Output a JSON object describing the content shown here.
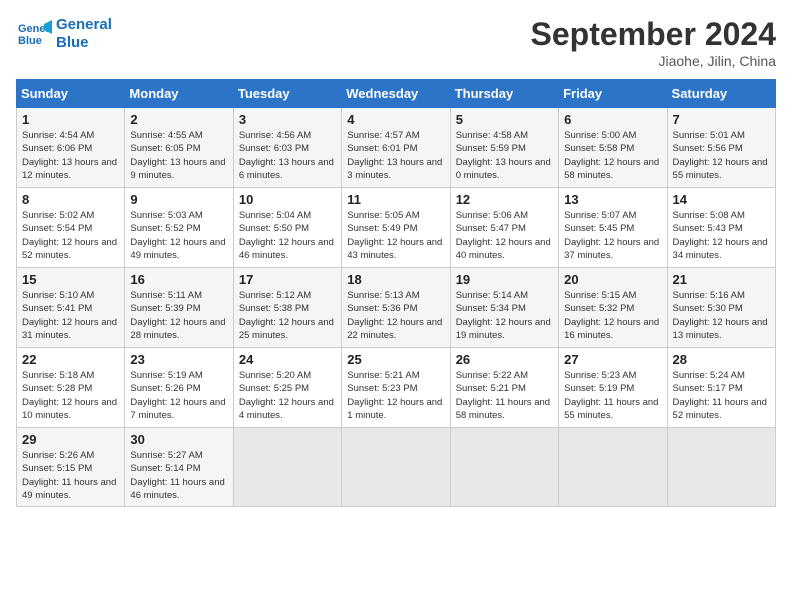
{
  "header": {
    "logo_line1": "General",
    "logo_line2": "Blue",
    "month": "September 2024",
    "location": "Jiaohe, Jilin, China"
  },
  "weekdays": [
    "Sunday",
    "Monday",
    "Tuesday",
    "Wednesday",
    "Thursday",
    "Friday",
    "Saturday"
  ],
  "weeks": [
    [
      {
        "day": "1",
        "sunrise": "Sunrise: 4:54 AM",
        "sunset": "Sunset: 6:06 PM",
        "daylight": "Daylight: 13 hours and 12 minutes."
      },
      {
        "day": "2",
        "sunrise": "Sunrise: 4:55 AM",
        "sunset": "Sunset: 6:05 PM",
        "daylight": "Daylight: 13 hours and 9 minutes."
      },
      {
        "day": "3",
        "sunrise": "Sunrise: 4:56 AM",
        "sunset": "Sunset: 6:03 PM",
        "daylight": "Daylight: 13 hours and 6 minutes."
      },
      {
        "day": "4",
        "sunrise": "Sunrise: 4:57 AM",
        "sunset": "Sunset: 6:01 PM",
        "daylight": "Daylight: 13 hours and 3 minutes."
      },
      {
        "day": "5",
        "sunrise": "Sunrise: 4:58 AM",
        "sunset": "Sunset: 5:59 PM",
        "daylight": "Daylight: 13 hours and 0 minutes."
      },
      {
        "day": "6",
        "sunrise": "Sunrise: 5:00 AM",
        "sunset": "Sunset: 5:58 PM",
        "daylight": "Daylight: 12 hours and 58 minutes."
      },
      {
        "day": "7",
        "sunrise": "Sunrise: 5:01 AM",
        "sunset": "Sunset: 5:56 PM",
        "daylight": "Daylight: 12 hours and 55 minutes."
      }
    ],
    [
      {
        "day": "8",
        "sunrise": "Sunrise: 5:02 AM",
        "sunset": "Sunset: 5:54 PM",
        "daylight": "Daylight: 12 hours and 52 minutes."
      },
      {
        "day": "9",
        "sunrise": "Sunrise: 5:03 AM",
        "sunset": "Sunset: 5:52 PM",
        "daylight": "Daylight: 12 hours and 49 minutes."
      },
      {
        "day": "10",
        "sunrise": "Sunrise: 5:04 AM",
        "sunset": "Sunset: 5:50 PM",
        "daylight": "Daylight: 12 hours and 46 minutes."
      },
      {
        "day": "11",
        "sunrise": "Sunrise: 5:05 AM",
        "sunset": "Sunset: 5:49 PM",
        "daylight": "Daylight: 12 hours and 43 minutes."
      },
      {
        "day": "12",
        "sunrise": "Sunrise: 5:06 AM",
        "sunset": "Sunset: 5:47 PM",
        "daylight": "Daylight: 12 hours and 40 minutes."
      },
      {
        "day": "13",
        "sunrise": "Sunrise: 5:07 AM",
        "sunset": "Sunset: 5:45 PM",
        "daylight": "Daylight: 12 hours and 37 minutes."
      },
      {
        "day": "14",
        "sunrise": "Sunrise: 5:08 AM",
        "sunset": "Sunset: 5:43 PM",
        "daylight": "Daylight: 12 hours and 34 minutes."
      }
    ],
    [
      {
        "day": "15",
        "sunrise": "Sunrise: 5:10 AM",
        "sunset": "Sunset: 5:41 PM",
        "daylight": "Daylight: 12 hours and 31 minutes."
      },
      {
        "day": "16",
        "sunrise": "Sunrise: 5:11 AM",
        "sunset": "Sunset: 5:39 PM",
        "daylight": "Daylight: 12 hours and 28 minutes."
      },
      {
        "day": "17",
        "sunrise": "Sunrise: 5:12 AM",
        "sunset": "Sunset: 5:38 PM",
        "daylight": "Daylight: 12 hours and 25 minutes."
      },
      {
        "day": "18",
        "sunrise": "Sunrise: 5:13 AM",
        "sunset": "Sunset: 5:36 PM",
        "daylight": "Daylight: 12 hours and 22 minutes."
      },
      {
        "day": "19",
        "sunrise": "Sunrise: 5:14 AM",
        "sunset": "Sunset: 5:34 PM",
        "daylight": "Daylight: 12 hours and 19 minutes."
      },
      {
        "day": "20",
        "sunrise": "Sunrise: 5:15 AM",
        "sunset": "Sunset: 5:32 PM",
        "daylight": "Daylight: 12 hours and 16 minutes."
      },
      {
        "day": "21",
        "sunrise": "Sunrise: 5:16 AM",
        "sunset": "Sunset: 5:30 PM",
        "daylight": "Daylight: 12 hours and 13 minutes."
      }
    ],
    [
      {
        "day": "22",
        "sunrise": "Sunrise: 5:18 AM",
        "sunset": "Sunset: 5:28 PM",
        "daylight": "Daylight: 12 hours and 10 minutes."
      },
      {
        "day": "23",
        "sunrise": "Sunrise: 5:19 AM",
        "sunset": "Sunset: 5:26 PM",
        "daylight": "Daylight: 12 hours and 7 minutes."
      },
      {
        "day": "24",
        "sunrise": "Sunrise: 5:20 AM",
        "sunset": "Sunset: 5:25 PM",
        "daylight": "Daylight: 12 hours and 4 minutes."
      },
      {
        "day": "25",
        "sunrise": "Sunrise: 5:21 AM",
        "sunset": "Sunset: 5:23 PM",
        "daylight": "Daylight: 12 hours and 1 minute."
      },
      {
        "day": "26",
        "sunrise": "Sunrise: 5:22 AM",
        "sunset": "Sunset: 5:21 PM",
        "daylight": "Daylight: 11 hours and 58 minutes."
      },
      {
        "day": "27",
        "sunrise": "Sunrise: 5:23 AM",
        "sunset": "Sunset: 5:19 PM",
        "daylight": "Daylight: 11 hours and 55 minutes."
      },
      {
        "day": "28",
        "sunrise": "Sunrise: 5:24 AM",
        "sunset": "Sunset: 5:17 PM",
        "daylight": "Daylight: 11 hours and 52 minutes."
      }
    ],
    [
      {
        "day": "29",
        "sunrise": "Sunrise: 5:26 AM",
        "sunset": "Sunset: 5:15 PM",
        "daylight": "Daylight: 11 hours and 49 minutes."
      },
      {
        "day": "30",
        "sunrise": "Sunrise: 5:27 AM",
        "sunset": "Sunset: 5:14 PM",
        "daylight": "Daylight: 11 hours and 46 minutes."
      },
      null,
      null,
      null,
      null,
      null
    ]
  ]
}
